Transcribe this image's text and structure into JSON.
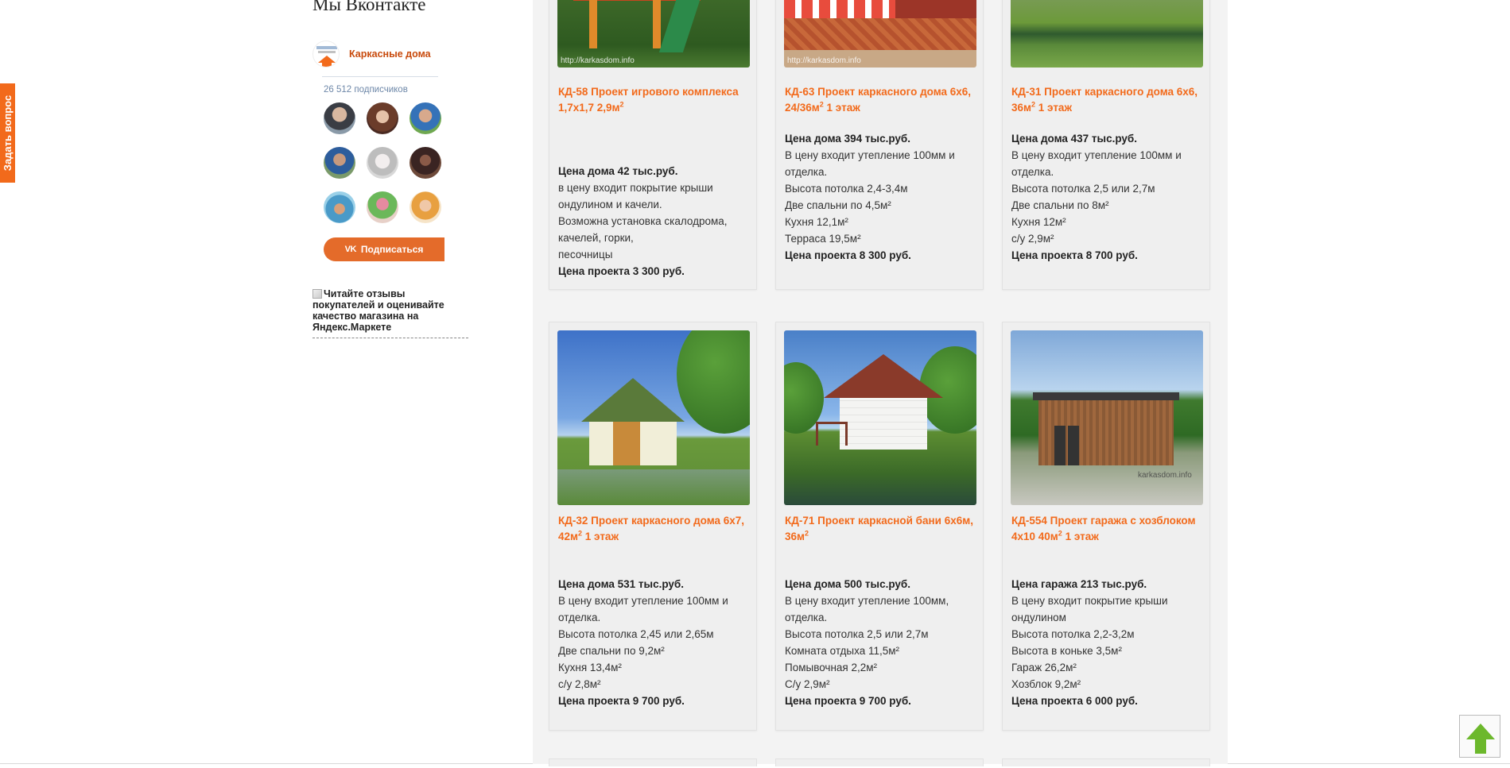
{
  "ask_tab": {
    "label": "Задать вопрос"
  },
  "sidebar": {
    "vk_title": "Мы Вконтакте",
    "group_name": "Каркасные дома",
    "subscribers": "26 512 подписчиков",
    "subscribe_label": "Подписаться",
    "vk_mark": "VK",
    "market_badge": "Читайте отзывы покупателей и оценивайте качество магазина на Яндекс.Маркете"
  },
  "cards": [
    {
      "title": "КД-58 Проект игрового комплекса 1,7х1,7 2,9м",
      "title_sup": "2",
      "title_tail": "",
      "watermark": "http://karkasdom.info",
      "price": "Цена дома 42 тыс.руб.",
      "lines": [
        "в цену входит покрытие крыши ондулином и качели.",
        "Возможна установка скалодрома, качелей, горки,",
        "песочницы"
      ],
      "project_price": "Цена проекта 3 300 руб."
    },
    {
      "title": "КД-63 Проект каркасного дома 6х6, 24/36м",
      "title_sup": "2",
      "title_tail": " 1 этаж",
      "watermark": "http://karkasdom.info",
      "price": "Цена дома 394 тыс.руб.",
      "lines": [
        "В цену входит утепление 100мм и отделка.",
        "Высота потолка 2,4-3,4м",
        "Две спальни по 4,5м²",
        "Кухня 12,1м²",
        "Терраса 19,5м²"
      ],
      "project_price": "Цена проекта 8 300 руб."
    },
    {
      "title": "КД-31 Проект каркасного дома 6х6, 36м",
      "title_sup": "2",
      "title_tail": " 1 этаж",
      "watermark": "",
      "price": "Цена дома 437 тыс.руб.",
      "lines": [
        "В цену входит утепление 100мм и отделка.",
        "Высота потолка 2,5 или 2,7м",
        "Две спальни по 8м²",
        "Кухня 12м²",
        "с/у 2,9м²"
      ],
      "project_price": "Цена проекта 8 700 руб."
    },
    {
      "title": "КД-32 Проект каркасного дома 6х7, 42м",
      "title_sup": "2",
      "title_tail": " 1 этаж",
      "watermark": "",
      "price": "Цена дома 531 тыс.руб.",
      "lines": [
        "В цену входит утепление 100мм и отделка.",
        "Высота потолка 2,45 или 2,65м",
        "Две спальни по 9,2м²",
        "Кухня 13,4м²",
        "с/у 2,8м²"
      ],
      "project_price": "Цена проекта 9 700 руб."
    },
    {
      "title": "КД-71 Проект каркасной бани 6х6м, 36м",
      "title_sup": "2",
      "title_tail": "",
      "watermark": "",
      "price": "Цена дома 500 тыс.руб.",
      "lines": [
        "В цену входит утепление 100мм, отделка.",
        "Высота потолка 2,5 или 2,7м",
        "Комната отдыха 11,5м²",
        "Помывочная 2,2м²",
        "С/у 2,9м²"
      ],
      "project_price": "Цена проекта 9 700 руб."
    },
    {
      "title": "КД-554 Проект гаража с хозблоком 4х10 40м",
      "title_sup": "2",
      "title_tail": " 1 этаж",
      "watermark": "karkasdom.info",
      "price": "Цена гаража 213 тыс.руб.",
      "lines": [
        "В цену входит покрытие крыши ондулином",
        "Высота потолка 2,2-3,2м",
        "Высота в коньке 3,5м²",
        "Гараж 26,2м²",
        "Хозблок 9,2м²"
      ],
      "project_price": "Цена проекта 6 000 руб."
    }
  ],
  "colors": {
    "accent": "#f26a1b",
    "vk_button": "#e46b2a",
    "to_top_arrow": "#6cb82c",
    "main_bg": "#f3f3f3"
  },
  "icons": {
    "to_top": "arrow-up-icon",
    "vk": "vk-icon"
  }
}
